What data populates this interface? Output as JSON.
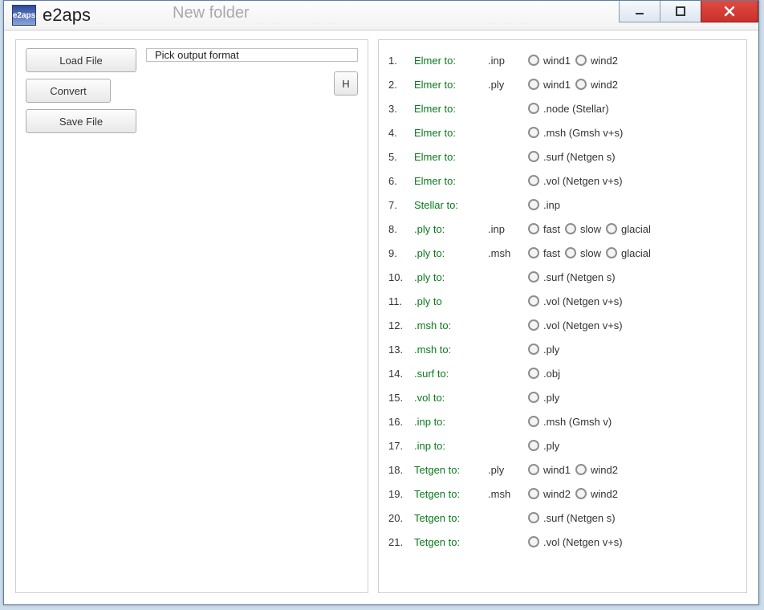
{
  "app": {
    "icon_text": "e2aps",
    "title": "e2aps",
    "ghost_behind": "New folder"
  },
  "left": {
    "load_label": "Load File",
    "convert_label": "Convert",
    "save_label": "Save File",
    "format_placeholder": "Pick output format",
    "h_button": "H"
  },
  "formats": [
    {
      "n": "1.",
      "from": "Elmer to:",
      "ext": ".inp",
      "opts": [
        "wind1",
        "wind2"
      ]
    },
    {
      "n": "2.",
      "from": "Elmer to:",
      "ext": ".ply",
      "opts": [
        "wind1",
        "wind2"
      ]
    },
    {
      "n": "3.",
      "from": "Elmer to:",
      "ext": "",
      "opts": [
        ".node (Stellar)"
      ]
    },
    {
      "n": "4.",
      "from": "Elmer to:",
      "ext": "",
      "opts": [
        ".msh (Gmsh v+s)"
      ]
    },
    {
      "n": "5.",
      "from": "Elmer to:",
      "ext": "",
      "opts": [
        ".surf (Netgen s)"
      ]
    },
    {
      "n": "6.",
      "from": "Elmer to:",
      "ext": "",
      "opts": [
        ".vol (Netgen v+s)"
      ]
    },
    {
      "n": "7.",
      "from": "Stellar to:",
      "ext": "",
      "opts": [
        ".inp"
      ]
    },
    {
      "n": "8.",
      "from": ".ply to:",
      "ext": ".inp",
      "opts": [
        "fast",
        "slow",
        "glacial"
      ]
    },
    {
      "n": "9.",
      "from": ".ply to:",
      "ext": ".msh",
      "opts": [
        "fast",
        "slow",
        "glacial"
      ]
    },
    {
      "n": "10.",
      "from": ".ply to:",
      "ext": "",
      "opts": [
        ".surf (Netgen s)"
      ]
    },
    {
      "n": "11.",
      "from": ".ply to",
      "ext": "",
      "opts": [
        ".vol (Netgen v+s)"
      ]
    },
    {
      "n": "12.",
      "from": ".msh to:",
      "ext": "",
      "opts": [
        ".vol (Netgen v+s)"
      ]
    },
    {
      "n": "13.",
      "from": ".msh to:",
      "ext": "",
      "opts": [
        ".ply"
      ]
    },
    {
      "n": "14.",
      "from": ".surf to:",
      "ext": "",
      "opts": [
        ".obj"
      ]
    },
    {
      "n": "15.",
      "from": ".vol to:",
      "ext": "",
      "opts": [
        ".ply"
      ]
    },
    {
      "n": "16.",
      "from": ".inp to:",
      "ext": "",
      "opts": [
        ".msh (Gmsh v)"
      ]
    },
    {
      "n": "17.",
      "from": ".inp to:",
      "ext": "",
      "opts": [
        ".ply"
      ]
    },
    {
      "n": "18.",
      "from": "Tetgen to:",
      "ext": ".ply",
      "opts": [
        "wind1",
        "wind2"
      ]
    },
    {
      "n": "19.",
      "from": "Tetgen to:",
      "ext": ".msh",
      "opts": [
        "wind2",
        "wind2"
      ]
    },
    {
      "n": "20.",
      "from": "Tetgen to:",
      "ext": "",
      "opts": [
        ".surf (Netgen s)"
      ]
    },
    {
      "n": "21.",
      "from": "Tetgen to:",
      "ext": "",
      "opts": [
        ".vol (Netgen v+s)"
      ]
    }
  ]
}
